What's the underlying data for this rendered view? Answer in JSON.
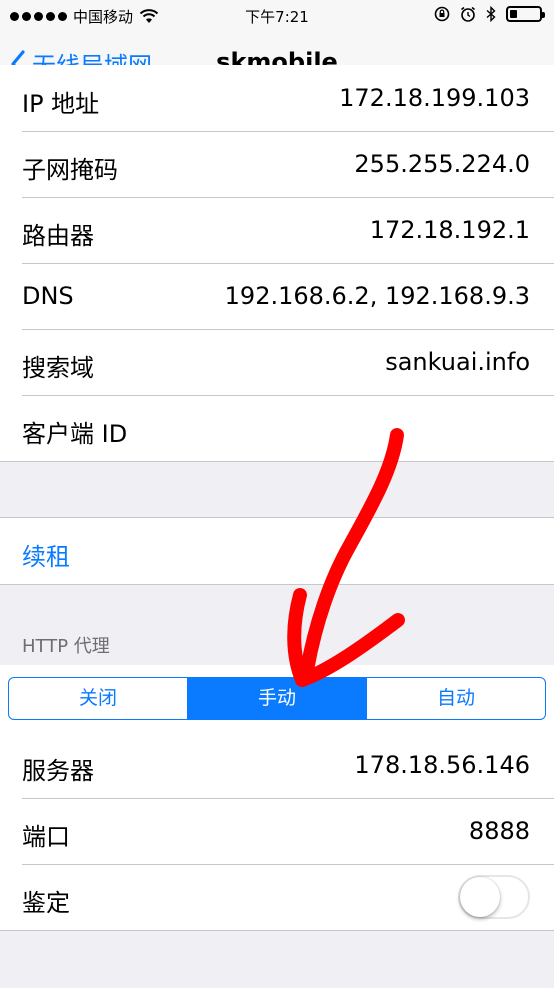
{
  "status": {
    "carrier": "中国移动",
    "time": "下午7:21"
  },
  "nav": {
    "back_label": "无线局域网",
    "title": "skmobile"
  },
  "info": {
    "ip_label": "IP 地址",
    "ip_value": "172.18.199.103",
    "subnet_label": "子网掩码",
    "subnet_value": "255.255.224.0",
    "router_label": "路由器",
    "router_value": "172.18.192.1",
    "dns_label": "DNS",
    "dns_value": "192.168.6.2, 192.168.9.3",
    "search_domain_label": "搜索域",
    "search_domain_value": "sankuai.info",
    "client_id_label": "客户端 ID",
    "client_id_value": ""
  },
  "renew_lease": "续租",
  "proxy": {
    "header": "HTTP 代理",
    "segments": [
      "关闭",
      "手动",
      "自动"
    ],
    "selected": "手动",
    "server_label": "服务器",
    "server_value": "178.18.56.146",
    "port_label": "端口",
    "port_value": "8888",
    "auth_label": "鉴定",
    "auth_enabled": false
  },
  "colors": {
    "accent": "#0a7aff",
    "annotation": "#ff0000"
  },
  "icons": [
    "wifi-icon",
    "rotation-lock-icon",
    "alarm-icon",
    "bluetooth-icon",
    "battery-icon",
    "back-chevron-icon"
  ]
}
